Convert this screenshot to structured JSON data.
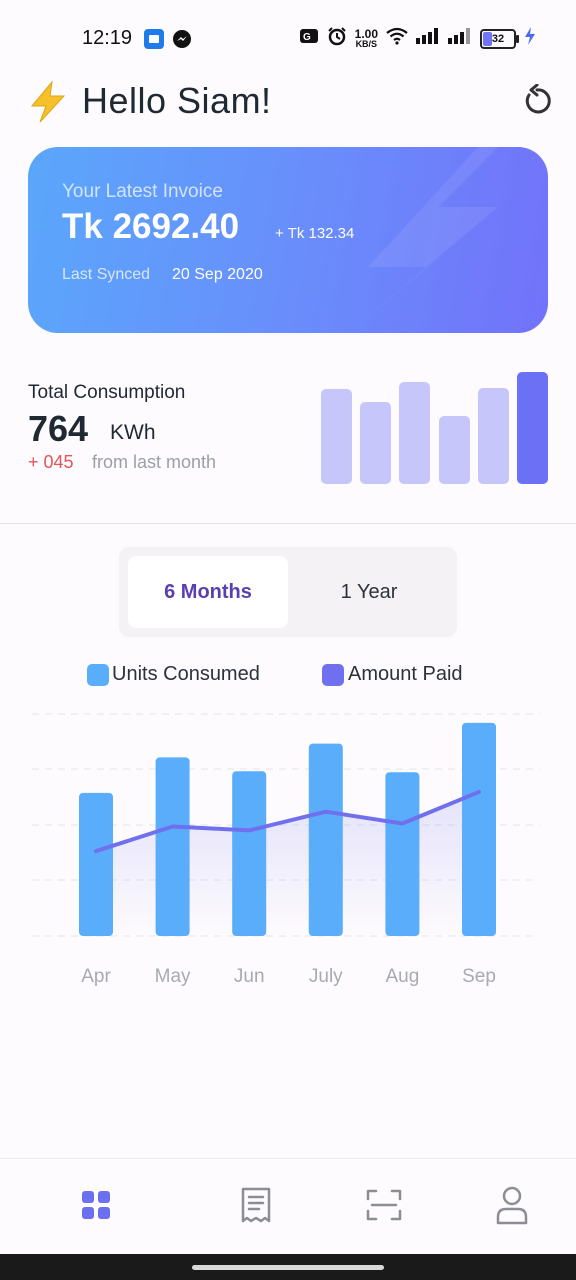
{
  "status_bar": {
    "time": "12:19",
    "net_speed": "1.00",
    "net_unit": "KB/S",
    "battery": "32"
  },
  "header": {
    "greeting": "Hello Siam!",
    "bolt_icon": "lightning-bolt-icon",
    "refresh_icon": "refresh-icon"
  },
  "invoice": {
    "label": "Your Latest Invoice",
    "amount": "Tk 2692.40",
    "extra": "+ Tk 132.34",
    "synced_label": "Last Synced",
    "synced_date": "20 Sep 2020"
  },
  "consumption": {
    "label": "Total Consumption",
    "value": "764",
    "unit": "KWh",
    "delta": "+ 045",
    "delta_suffix": "from last month",
    "mini_bars": [
      0.85,
      0.73,
      0.91,
      0.61,
      0.86,
      1.0
    ]
  },
  "toggle": {
    "options": [
      "6 Months",
      "1 Year"
    ],
    "selected": "6 Months"
  },
  "legend": {
    "units": "Units Consumed",
    "amount": "Amount Paid"
  },
  "colors": {
    "units": "#5aadfb",
    "amount": "#7070ee",
    "active_tab": "#5b3fae",
    "delta": "#e2555a",
    "nav_active": "#6c70ee",
    "nav_inactive": "#8b8f95"
  },
  "chart_data": {
    "type": "bar",
    "categories": [
      "Apr",
      "May",
      "Jun",
      "July",
      "Aug",
      "Sep"
    ],
    "series": [
      {
        "name": "Units Consumed",
        "values": [
          145,
          181,
          167,
          195,
          166,
          216
        ]
      },
      {
        "name": "Amount Paid",
        "values": [
          86,
          111,
          107,
          126,
          114,
          146
        ]
      }
    ],
    "ylim": [
      0,
      225
    ],
    "grid": true
  },
  "bottom_nav": [
    {
      "icon": "dashboard-grid-icon",
      "active": true
    },
    {
      "icon": "receipt-icon",
      "active": false
    },
    {
      "icon": "scan-icon",
      "active": false
    },
    {
      "icon": "profile-icon",
      "active": false
    }
  ]
}
